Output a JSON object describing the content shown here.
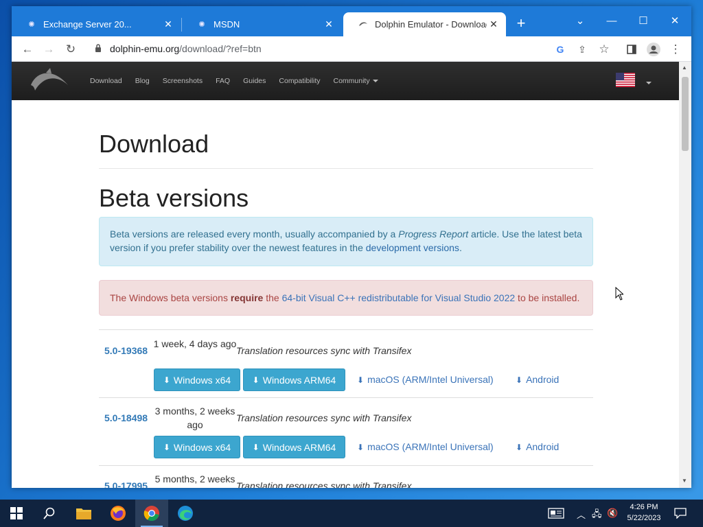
{
  "browser": {
    "tabs": [
      {
        "label": "Exchange Server 20...",
        "active": false
      },
      {
        "label": "MSDN",
        "active": false
      },
      {
        "label": "Dolphin Emulator - Download",
        "active": true
      }
    ],
    "url_host": "dolphin-emu.org",
    "url_path": "/download/?ref=btn"
  },
  "site": {
    "nav": [
      "Download",
      "Blog",
      "Screenshots",
      "FAQ",
      "Guides",
      "Compatibility",
      "Community"
    ]
  },
  "page": {
    "title": "Download",
    "section_title": "Beta versions",
    "info": {
      "part1": "Beta versions are released every month, usually accompanied by a ",
      "em": "Progress Report",
      "part2": " article. Use the latest beta version if you prefer stability over the newest features in the ",
      "link": "development versions",
      "part3": "."
    },
    "warning": {
      "part1": "The Windows beta versions ",
      "bold": "require",
      "part2": " the ",
      "link": "64-bit Visual C++ redistributable for Visual Studio 2022",
      "part3": " to be installed."
    },
    "versions": [
      {
        "version": "5.0-19368",
        "age": "1 week, 4 days ago",
        "message": "Translation resources sync with Transifex"
      },
      {
        "version": "5.0-18498",
        "age": "3 months, 2 weeks ago",
        "message": "Translation resources sync with Transifex"
      },
      {
        "version": "5.0-17995",
        "age": "5 months, 2 weeks",
        "message": "Translation resources sync with Transifex"
      }
    ],
    "downloads": {
      "win64": "Windows x64",
      "winarm": "Windows ARM64",
      "mac": "macOS (ARM/Intel Universal)",
      "android": "Android"
    }
  },
  "taskbar": {
    "time": "4:26 PM",
    "date": "5/22/2023"
  }
}
